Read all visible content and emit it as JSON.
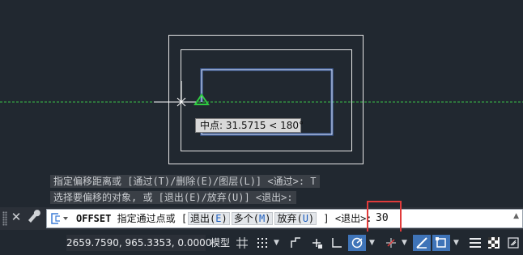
{
  "drawing": {
    "tooltip": "中点: 31.5715 < 180°"
  },
  "history": {
    "line1": "指定偏移距离或 [通过(T)/删除(E)/图层(L)] <通过>:  T",
    "line2": "选择要偏移的对象, 或 [退出(E)/放弃(U)] <退出>:"
  },
  "command": {
    "name": "OFFSET",
    "prompt": "指定通过点或 [",
    "options": [
      {
        "label": "退出(",
        "key": "E",
        "close": ")"
      },
      {
        "label": "多个(",
        "key": "M",
        "close": ")"
      },
      {
        "label": "放弃(",
        "key": "U",
        "close": ")"
      }
    ],
    "suffix": "] <退出>:",
    "value": "30"
  },
  "status": {
    "coordinates": "2659.7590, 965.3353, 0.0000",
    "model_label": "模型"
  },
  "colors": {
    "background": "#212830",
    "selected_polyline": "#6f9cff",
    "highlight_box": "#e03b3b",
    "snap_marker": "#2ecc40",
    "active_button": "#3f74b8"
  },
  "icons": [
    "close-icon",
    "wrench-icon",
    "offset-command-icon",
    "grid-icon",
    "snap-icon",
    "ortho-icon",
    "polar-icon",
    "osnap-icon",
    "lineweight-icon",
    "transparency-icon",
    "selection-cycling-icon",
    "properties-icon"
  ]
}
